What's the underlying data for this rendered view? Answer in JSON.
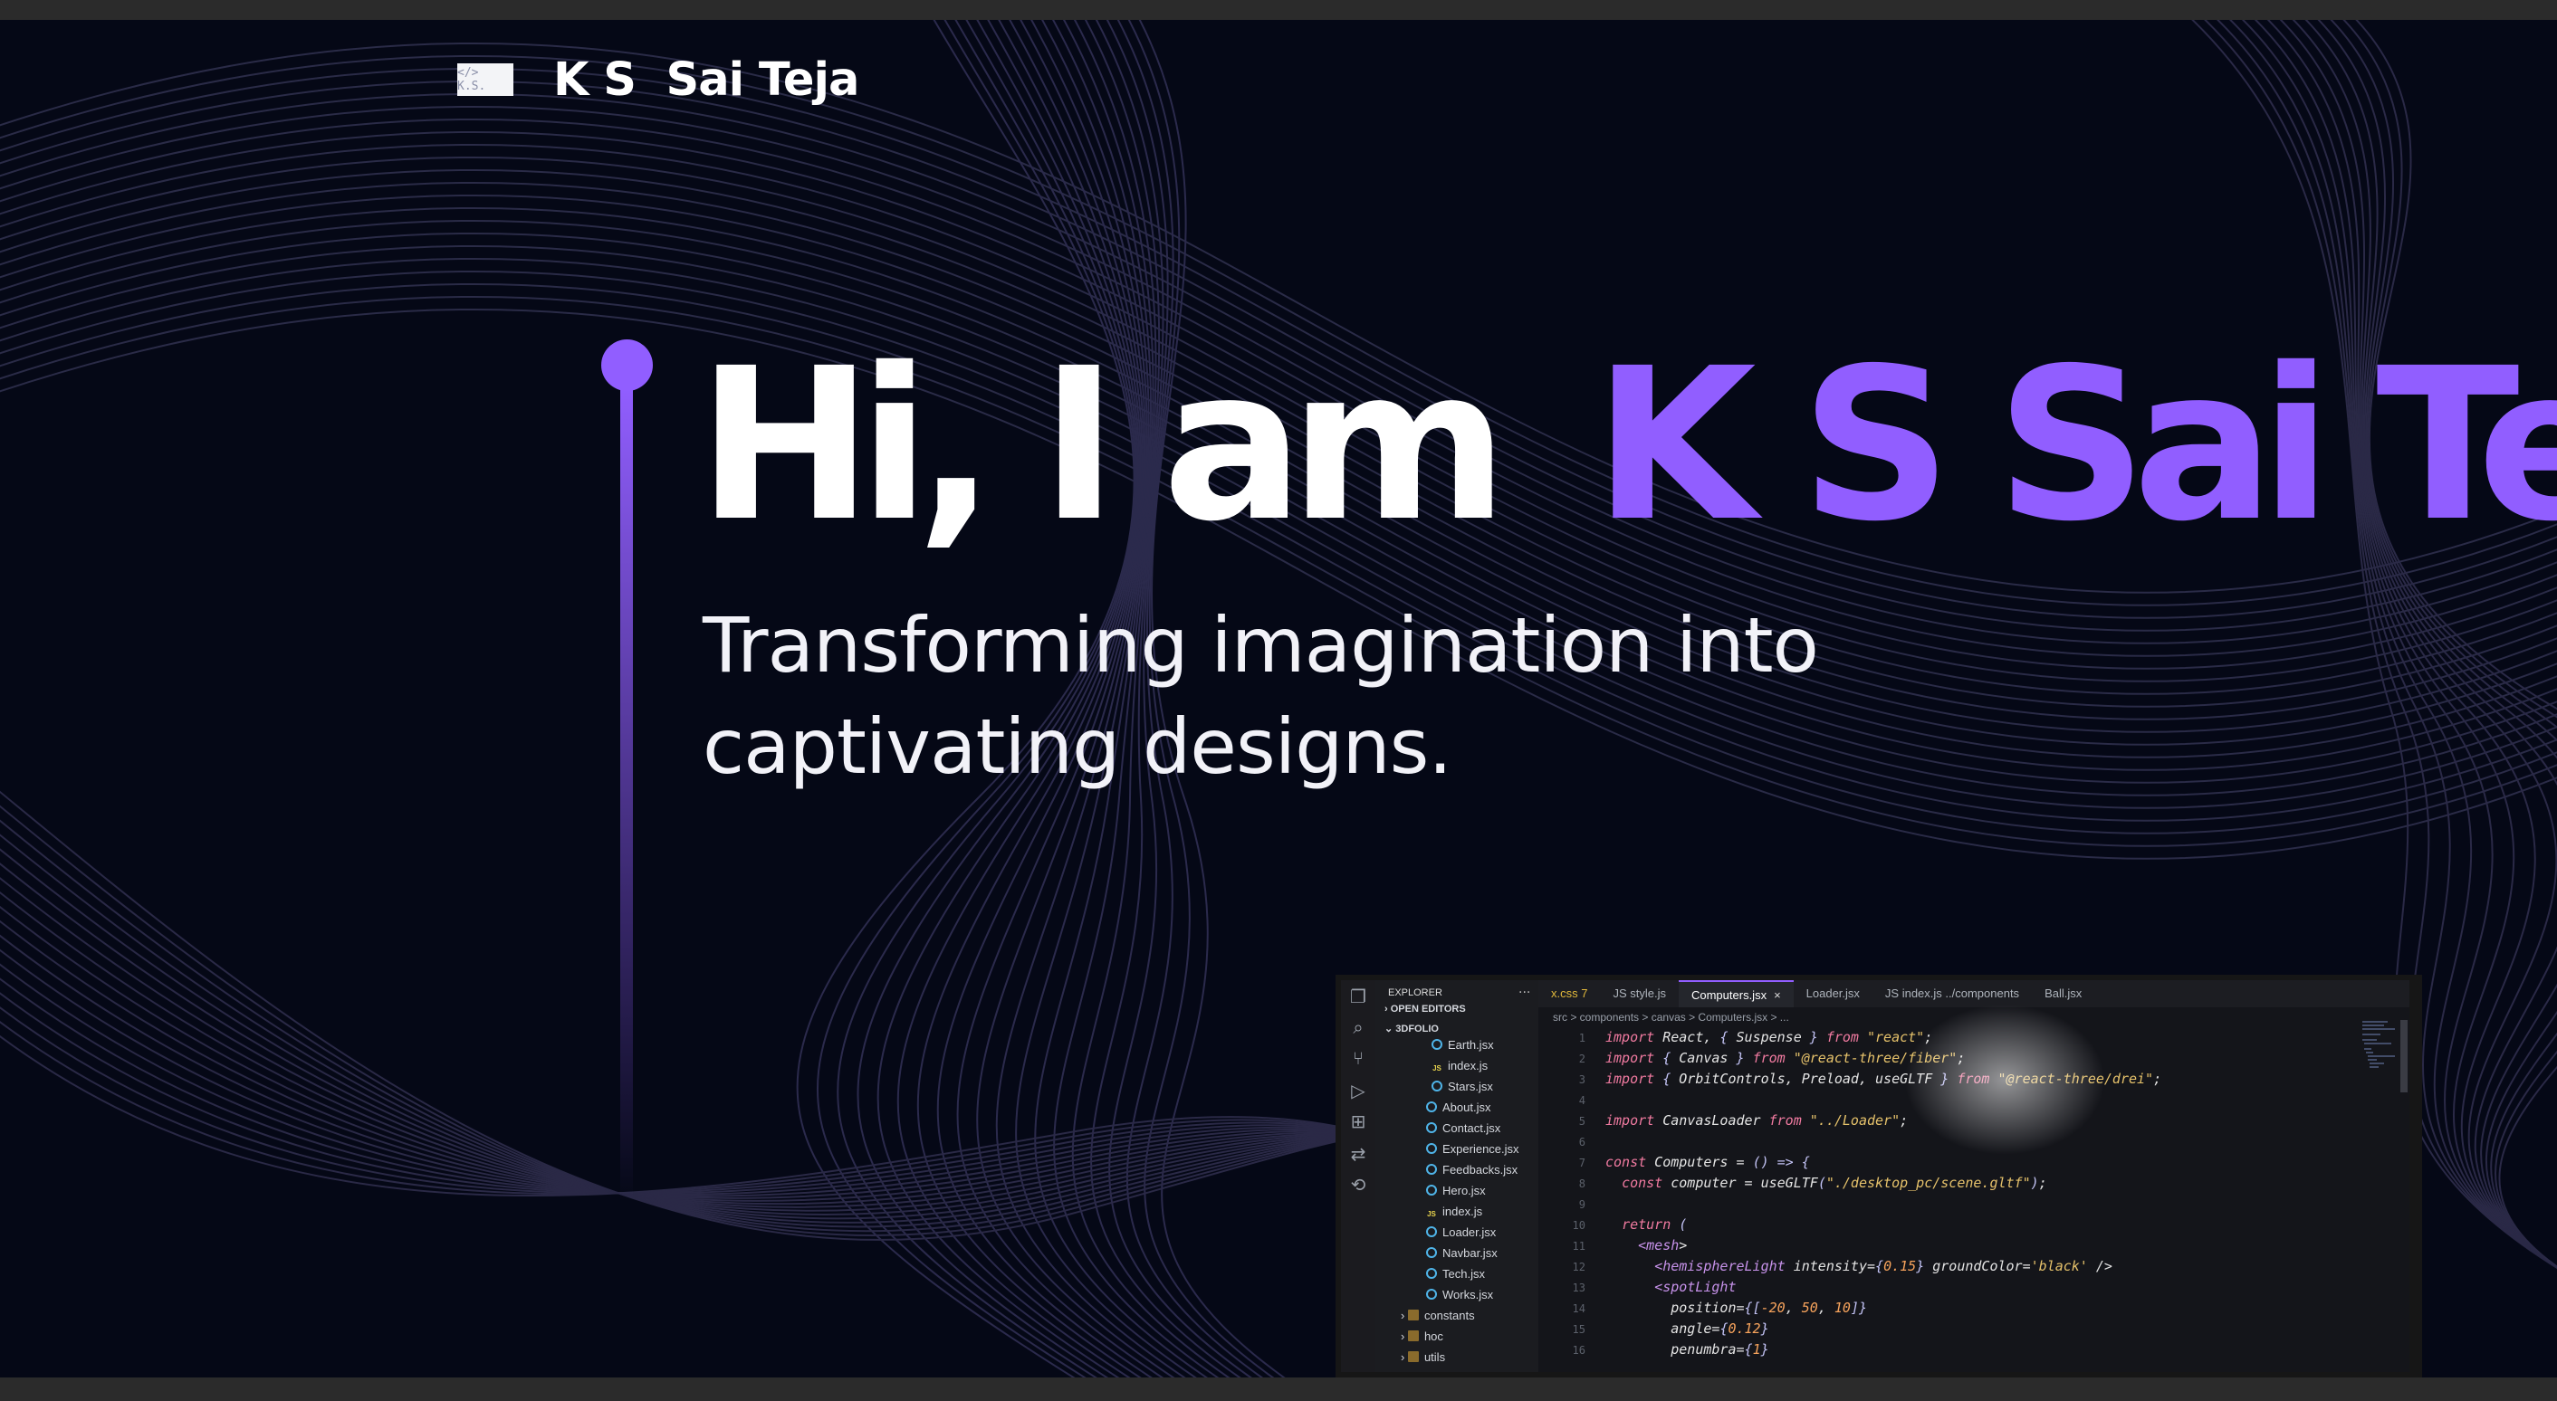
{
  "nav": {
    "logo_text": "</> K.S.",
    "brand": "K S  Sai Teja"
  },
  "hero": {
    "greeting": "Hi, I am",
    "name": "K S Sai Teja",
    "subtitle_line1": "Transforming imagination into",
    "subtitle_line2": "captivating designs."
  },
  "editor": {
    "explorer_title": "EXPLORER",
    "explorer_menu": "···",
    "open_editors": "OPEN EDITORS",
    "project": "3DFOLIO",
    "files": [
      {
        "name": "Earth.jsx",
        "type": "react",
        "indent": 2
      },
      {
        "name": "index.js",
        "type": "js",
        "indent": 2
      },
      {
        "name": "Stars.jsx",
        "type": "react",
        "indent": 2
      },
      {
        "name": "About.jsx",
        "type": "react",
        "indent": 1
      },
      {
        "name": "Contact.jsx",
        "type": "react",
        "indent": 1
      },
      {
        "name": "Experience.jsx",
        "type": "react",
        "indent": 1
      },
      {
        "name": "Feedbacks.jsx",
        "type": "react",
        "indent": 1
      },
      {
        "name": "Hero.jsx",
        "type": "react",
        "indent": 1
      },
      {
        "name": "index.js",
        "type": "js",
        "indent": 1
      },
      {
        "name": "Loader.jsx",
        "type": "react",
        "indent": 1
      },
      {
        "name": "Navbar.jsx",
        "type": "react",
        "indent": 1
      },
      {
        "name": "Tech.jsx",
        "type": "react",
        "indent": 1
      },
      {
        "name": "Works.jsx",
        "type": "react",
        "indent": 1
      },
      {
        "name": "constants",
        "type": "folder",
        "indent": 0
      },
      {
        "name": "hoc",
        "type": "folder",
        "indent": 0
      },
      {
        "name": "utils",
        "type": "folder",
        "indent": 0
      }
    ],
    "tabs": [
      {
        "label": "x.css 7",
        "active": false,
        "color": "#e2b93b"
      },
      {
        "label": "JS style.js",
        "active": false,
        "color": "#aeb4bc"
      },
      {
        "label": "Computers.jsx",
        "active": true,
        "color": "#ffffff"
      },
      {
        "label": "Loader.jsx",
        "active": false,
        "color": "#aeb4bc"
      },
      {
        "label": "JS index.js ../components",
        "active": false,
        "color": "#aeb4bc"
      },
      {
        "label": "Ball.jsx",
        "active": false,
        "color": "#aeb4bc"
      }
    ],
    "tab_close": "×",
    "breadcrumb": "src > components > canvas > Computers.jsx > ...",
    "code": [
      {
        "n": "1",
        "text": "import React, { Suspense } from \"react\";"
      },
      {
        "n": "2",
        "text": "import { Canvas } from \"@react-three/fiber\";"
      },
      {
        "n": "3",
        "text": "import { OrbitControls, Preload, useGLTF } from \"@react-three/drei\";"
      },
      {
        "n": "4",
        "text": ""
      },
      {
        "n": "5",
        "text": "import CanvasLoader from \"../Loader\";"
      },
      {
        "n": "6",
        "text": ""
      },
      {
        "n": "7",
        "text": "const Computers = () => {"
      },
      {
        "n": "8",
        "text": "  const computer = useGLTF(\"./desktop_pc/scene.gltf\");"
      },
      {
        "n": "9",
        "text": ""
      },
      {
        "n": "10",
        "text": "  return ("
      },
      {
        "n": "11",
        "text": "    <mesh>"
      },
      {
        "n": "12",
        "text": "      <hemisphereLight intensity={0.15} groundColor='black' />"
      },
      {
        "n": "13",
        "text": "      <spotLight"
      },
      {
        "n": "14",
        "text": "        position={[-20, 50, 10]}"
      },
      {
        "n": "15",
        "text": "        angle={0.12}"
      },
      {
        "n": "16",
        "text": "        penumbra={1}"
      }
    ]
  },
  "colors": {
    "accent": "#915eff",
    "background": "#050816"
  }
}
